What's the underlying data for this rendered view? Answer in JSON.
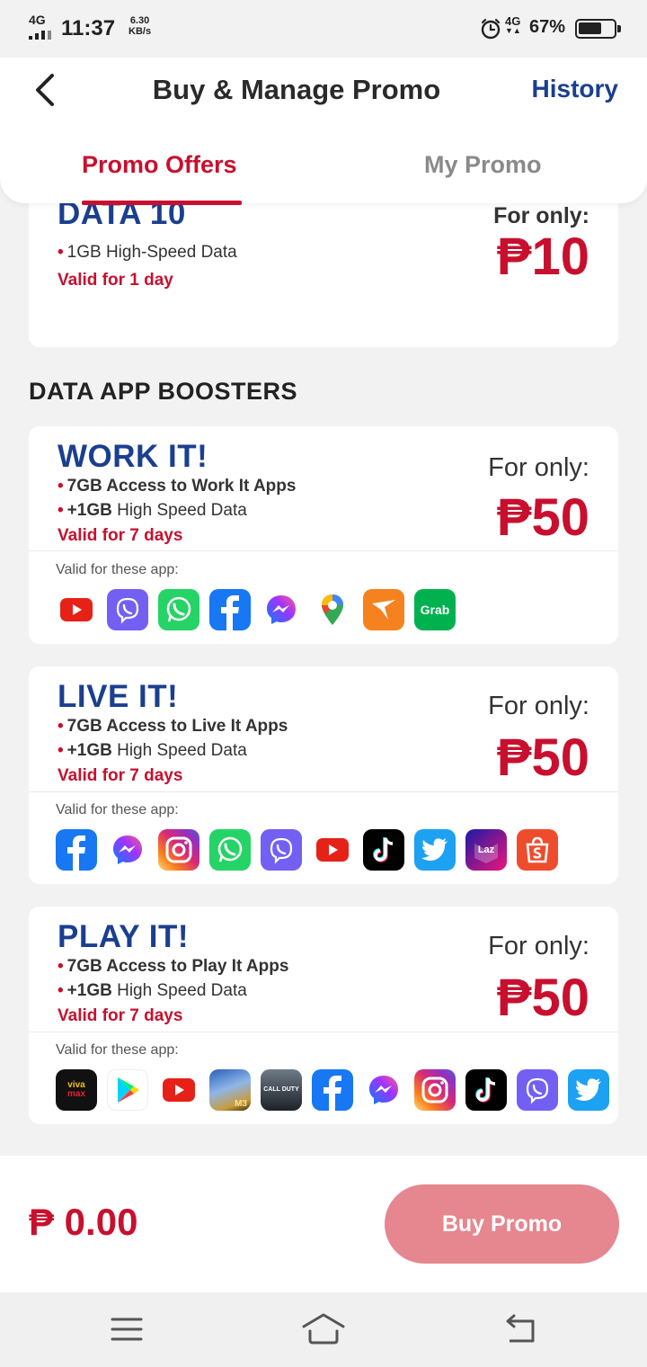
{
  "status_bar": {
    "network": "4G",
    "time": "11:37",
    "speed_value": "6.30",
    "speed_unit": "KB/s",
    "network2": "4G",
    "battery_percent": "67%",
    "battery_level": 0.67
  },
  "header": {
    "title": "Buy & Manage Promo",
    "history_label": "History",
    "tabs": [
      {
        "label": "Promo Offers",
        "active": true
      },
      {
        "label": "My Promo",
        "active": false
      }
    ]
  },
  "data10": {
    "name": "DATA 10",
    "line1": "1GB High-Speed Data",
    "validity": "Valid for 1 day",
    "for_only": "For only:",
    "price": "₱10"
  },
  "section_title": "DATA APP BOOSTERS",
  "cards": [
    {
      "name": "WORK IT!",
      "line1_bold": "7GB Access to Work It Apps",
      "line2_bold": "+1GB",
      "line2_rest": " High Speed Data",
      "validity": "Valid for 7 days",
      "for_only": "For only:",
      "price": "₱50",
      "apps_label": "Valid for these app:",
      "apps": [
        "youtube-icon",
        "viber-icon",
        "whatsapp-icon",
        "facebook-icon",
        "messenger-icon",
        "google-maps-icon",
        "lalamove-icon",
        "grab-icon"
      ]
    },
    {
      "name": "LIVE IT!",
      "line1_bold": "7GB Access to Live It Apps",
      "line2_bold": "+1GB",
      "line2_rest": " High Speed Data",
      "validity": "Valid for 7 days",
      "for_only": "For only:",
      "price": "₱50",
      "apps_label": "Valid for these app:",
      "apps": [
        "facebook-icon",
        "messenger-icon",
        "instagram-icon",
        "whatsapp-icon",
        "viber-icon",
        "youtube-icon",
        "tiktok-icon",
        "twitter-icon",
        "lazada-icon",
        "shopee-icon"
      ]
    },
    {
      "name": "PLAY IT!",
      "line1_bold": "7GB Access to Play It Apps",
      "line2_bold": "+1GB",
      "line2_rest": " High Speed Data",
      "validity": "Valid for 7 days",
      "for_only": "For only:",
      "price": "₱50",
      "apps_label": "Valid for these app:",
      "apps": [
        "vivamax-icon",
        "google-play-icon",
        "youtube-icon",
        "mobile-legends-icon",
        "call-of-duty-icon",
        "facebook-icon",
        "messenger-icon",
        "instagram-icon",
        "tiktok-icon",
        "viber-icon",
        "twitter-icon"
      ]
    }
  ],
  "app_text": {
    "grab": "Grab",
    "lazada": "Laz",
    "vivamax_top": "viva",
    "vivamax_bottom": "max",
    "mobile_legends": "M3",
    "call_of_duty": "CALL DUTY"
  },
  "footer": {
    "total": "₱ 0.00",
    "buy_label": "Buy Promo"
  },
  "colors": {
    "accent_red": "#c8102e",
    "brand_blue": "#1b3f8f",
    "buy_button_disabled": "#e6868e"
  }
}
